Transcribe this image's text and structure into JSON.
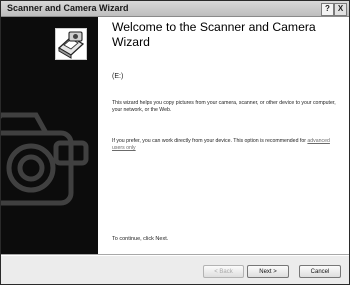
{
  "window": {
    "title": "Scanner and Camera Wizard",
    "help_label": "?",
    "close_label": "X"
  },
  "sidebar": {
    "wizard_icon": "scanner-camera-icon",
    "watermark_icon": "scanner-camera-watermark-icon"
  },
  "main": {
    "heading": "Welcome to the Scanner and Camera Wizard",
    "device_label": "(E:)",
    "intro_text": "This wizard helps you copy pictures from your camera, scanner, or other device to your computer, your network, or the Web.",
    "prefer_text": "If you prefer, you can work directly from your device. This option is recommended for",
    "advanced_link": "advanced users only",
    "continue_text": "To continue, click Next."
  },
  "buttons": {
    "back_label": "< Back",
    "next_label": "Next >",
    "cancel_label": "Cancel"
  }
}
